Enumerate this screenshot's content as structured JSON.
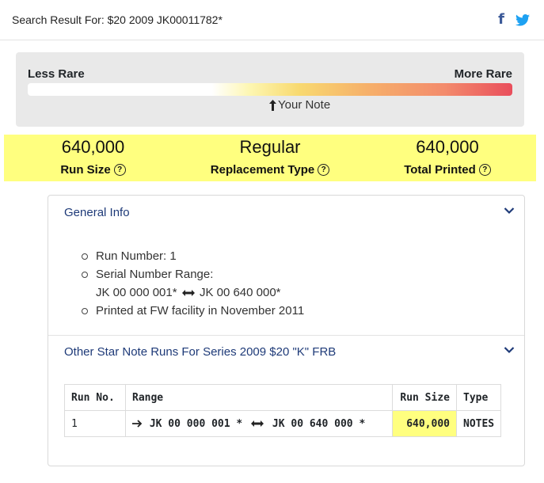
{
  "header": {
    "search_title": "Search Result For: $20 2009 JK00011782*",
    "social": [
      "facebook-icon",
      "twitter-icon"
    ]
  },
  "rarity": {
    "less_label": "Less Rare",
    "more_label": "More Rare",
    "your_note_label": "Your Note"
  },
  "stats": [
    {
      "value": "640,000",
      "label": "Run Size"
    },
    {
      "value": "Regular",
      "label": "Replacement Type"
    },
    {
      "value": "640,000",
      "label": "Total Printed"
    }
  ],
  "general_info": {
    "title": "General Info",
    "run_number": "Run Number: 1",
    "serial_label": "Serial Number Range:",
    "serial_start": "JK 00 000 001*",
    "serial_end": "JK 00 640 000*",
    "printed": "Printed at FW facility in November 2011"
  },
  "other_runs": {
    "title": "Other Star Note Runs For Series 2009 $20 \"K\" FRB",
    "columns": [
      "Run No.",
      "Range",
      "Run Size",
      "Type"
    ],
    "rows": [
      {
        "run_no": "1",
        "range_start": "JK 00 000 001 *",
        "range_end": "JK 00 640 000 *",
        "run_size": "640,000",
        "type": "NOTES"
      }
    ]
  },
  "colors": {
    "highlight": "#ffff7f",
    "link": "#1e3a78",
    "facebook": "#3b5998",
    "twitter": "#1da1f2"
  }
}
